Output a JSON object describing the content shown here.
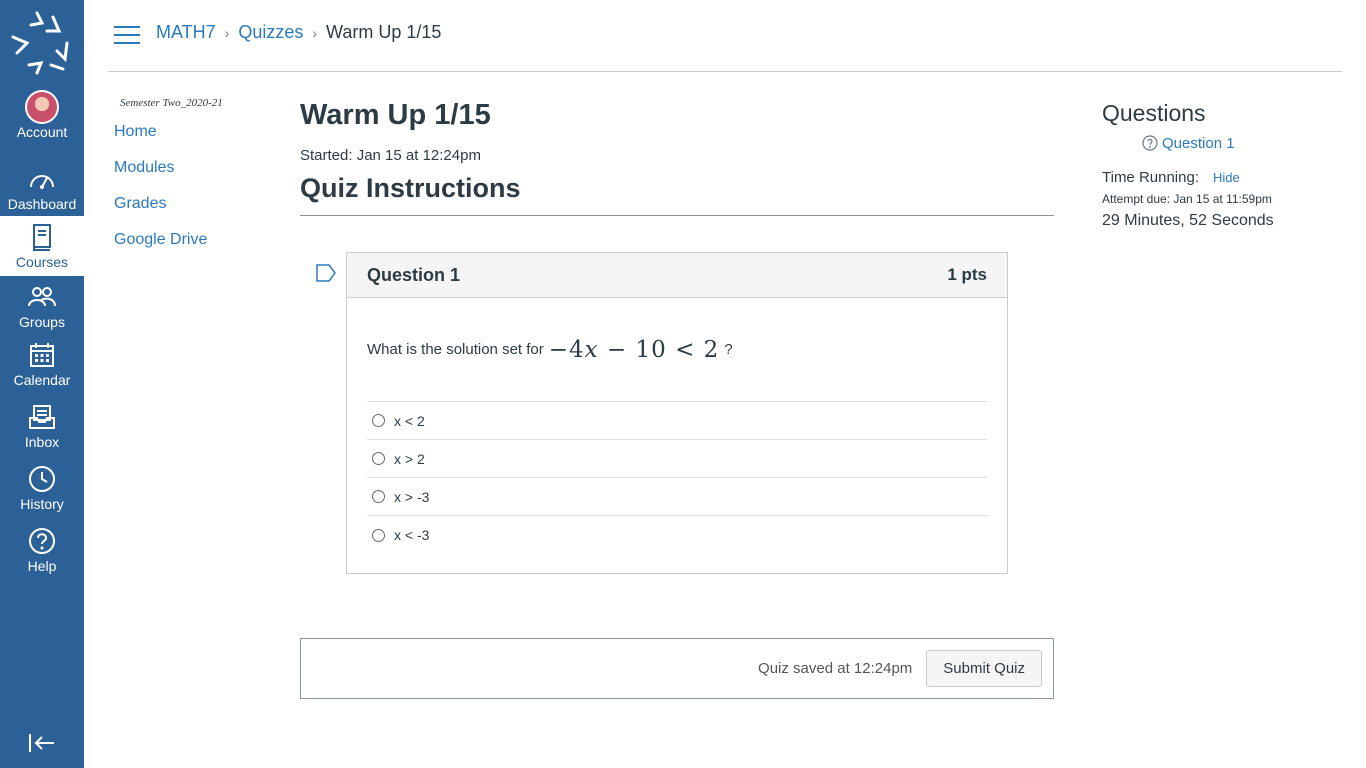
{
  "global_nav": {
    "items": [
      {
        "label": "Account",
        "icon": "avatar"
      },
      {
        "label": "Dashboard",
        "icon": "dashboard-icon"
      },
      {
        "label": "Courses",
        "icon": "courses-icon"
      },
      {
        "label": "Groups",
        "icon": "groups-icon"
      },
      {
        "label": "Calendar",
        "icon": "calendar-icon"
      },
      {
        "label": "Inbox",
        "icon": "inbox-icon"
      },
      {
        "label": "History",
        "icon": "history-icon"
      },
      {
        "label": "Help",
        "icon": "help-icon"
      }
    ],
    "active": "Courses",
    "color": "#2b6197"
  },
  "breadcrumb": {
    "course": "MATH7",
    "section": "Quizzes",
    "current": "Warm Up 1/15",
    "separator": "›"
  },
  "course_nav": {
    "term": "Semester Two_2020-21",
    "links": [
      "Home",
      "Modules",
      "Grades",
      "Google Drive"
    ]
  },
  "quiz": {
    "title": "Warm Up 1/15",
    "started": "Started: Jan 15 at 12:24pm",
    "instructions_heading": "Quiz Instructions",
    "question": {
      "name": "Question 1",
      "points": "1 pts",
      "text_before": "What is the solution set for",
      "math": "−4𝑥 − 10 < 2",
      "text_after": "?",
      "answers": [
        "x < 2",
        "x > 2",
        "x > -3",
        "x < -3"
      ]
    },
    "saved_text": "Quiz saved at 12:24pm",
    "submit_label": "Submit Quiz"
  },
  "sidebar": {
    "heading": "Questions",
    "question_link": "Question 1",
    "time_running_label": "Time Running:",
    "hide_label": "Hide",
    "attempt_due": "Attempt due: Jan 15 at 11:59pm",
    "timer": "29 Minutes, 52 Seconds"
  },
  "colors": {
    "link": "#2b7abc",
    "nav": "#2b6197"
  }
}
